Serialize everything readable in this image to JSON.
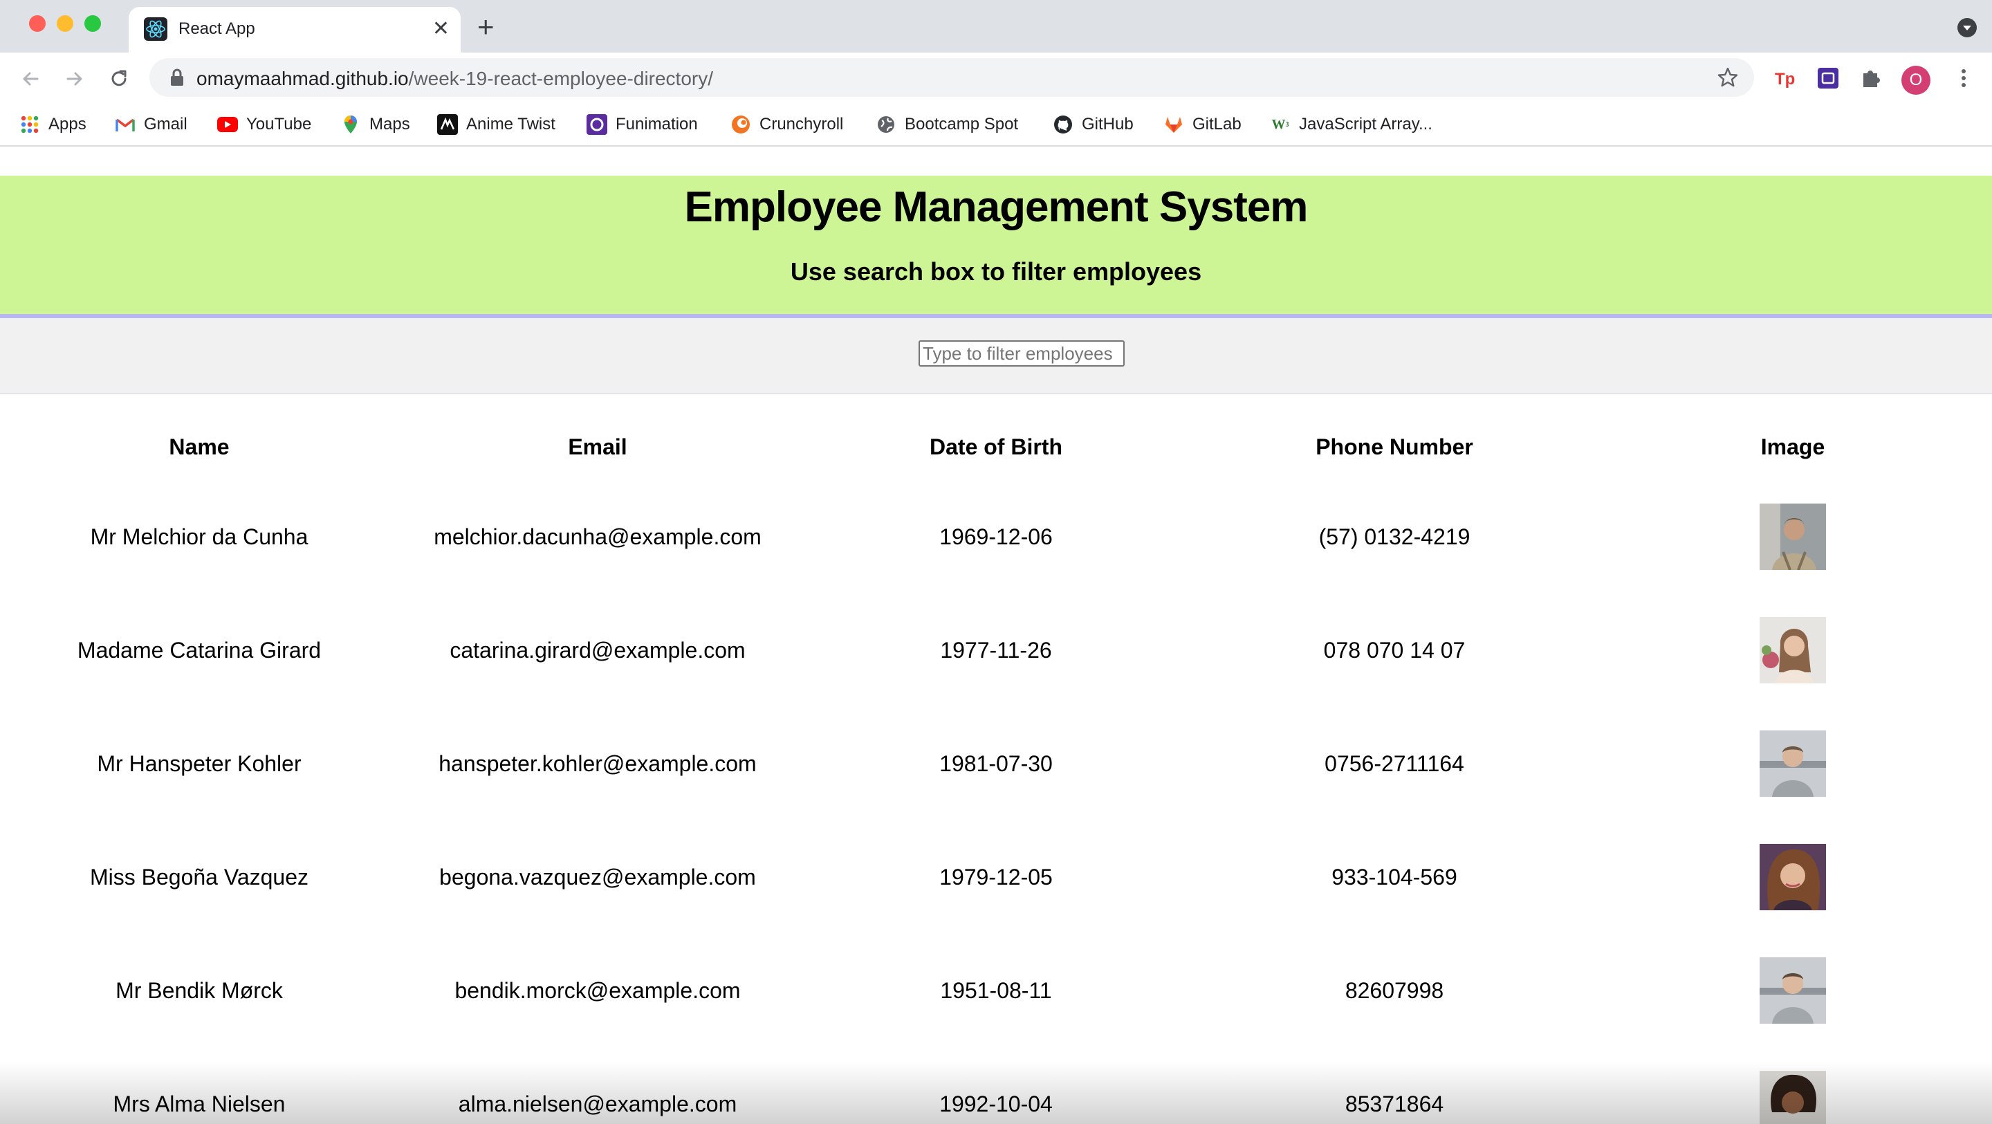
{
  "browser": {
    "tab_title": "React App",
    "url_host": "omaymaahmad.github.io",
    "url_path": "/week-19-react-employee-directory/",
    "profile_initial": "O",
    "bookmarks": [
      {
        "label": "Apps",
        "icon": "apps-grid-icon"
      },
      {
        "label": "Gmail",
        "icon": "gmail-icon"
      },
      {
        "label": "YouTube",
        "icon": "youtube-icon"
      },
      {
        "label": "Maps",
        "icon": "maps-icon"
      },
      {
        "label": "Anime Twist",
        "icon": "anime-twist-icon"
      },
      {
        "label": "Funimation",
        "icon": "funimation-icon"
      },
      {
        "label": "Crunchyroll",
        "icon": "crunchyroll-icon"
      },
      {
        "label": "Bootcamp Spot",
        "icon": "globe-icon"
      },
      {
        "label": "GitHub",
        "icon": "github-icon"
      },
      {
        "label": "GitLab",
        "icon": "gitlab-icon"
      },
      {
        "label": "JavaScript Array...",
        "icon": "w3schools-icon"
      }
    ]
  },
  "header": {
    "title": "Employee Management System",
    "subtitle": "Use search box to filter employees"
  },
  "search": {
    "placeholder": "Type to filter employees",
    "value": ""
  },
  "table": {
    "columns": [
      "Name",
      "Email",
      "Date of Birth",
      "Phone Number",
      "Image"
    ],
    "rows": [
      {
        "name": "Mr Melchior da Cunha",
        "email": "melchior.dacunha@example.com",
        "dob": "1969-12-06",
        "phone": "(57) 0132-4219"
      },
      {
        "name": "Madame Catarina Girard",
        "email": "catarina.girard@example.com",
        "dob": "1977-11-26",
        "phone": "078 070 14 07"
      },
      {
        "name": "Mr Hanspeter Kohler",
        "email": "hanspeter.kohler@example.com",
        "dob": "1981-07-30",
        "phone": "0756-2711164"
      },
      {
        "name": "Miss Begoña Vazquez",
        "email": "begona.vazquez@example.com",
        "dob": "1979-12-05",
        "phone": "933-104-569"
      },
      {
        "name": "Mr Bendik Mørck",
        "email": "bendik.morck@example.com",
        "dob": "1951-08-11",
        "phone": "82607998"
      },
      {
        "name": "Mrs Alma Nielsen",
        "email": "alma.nielsen@example.com",
        "dob": "1992-10-04",
        "phone": "85371864"
      }
    ]
  },
  "colors": {
    "header_bg": "#cef595",
    "header_border": "#b9b7f2",
    "search_bg": "#f1f1f2"
  }
}
